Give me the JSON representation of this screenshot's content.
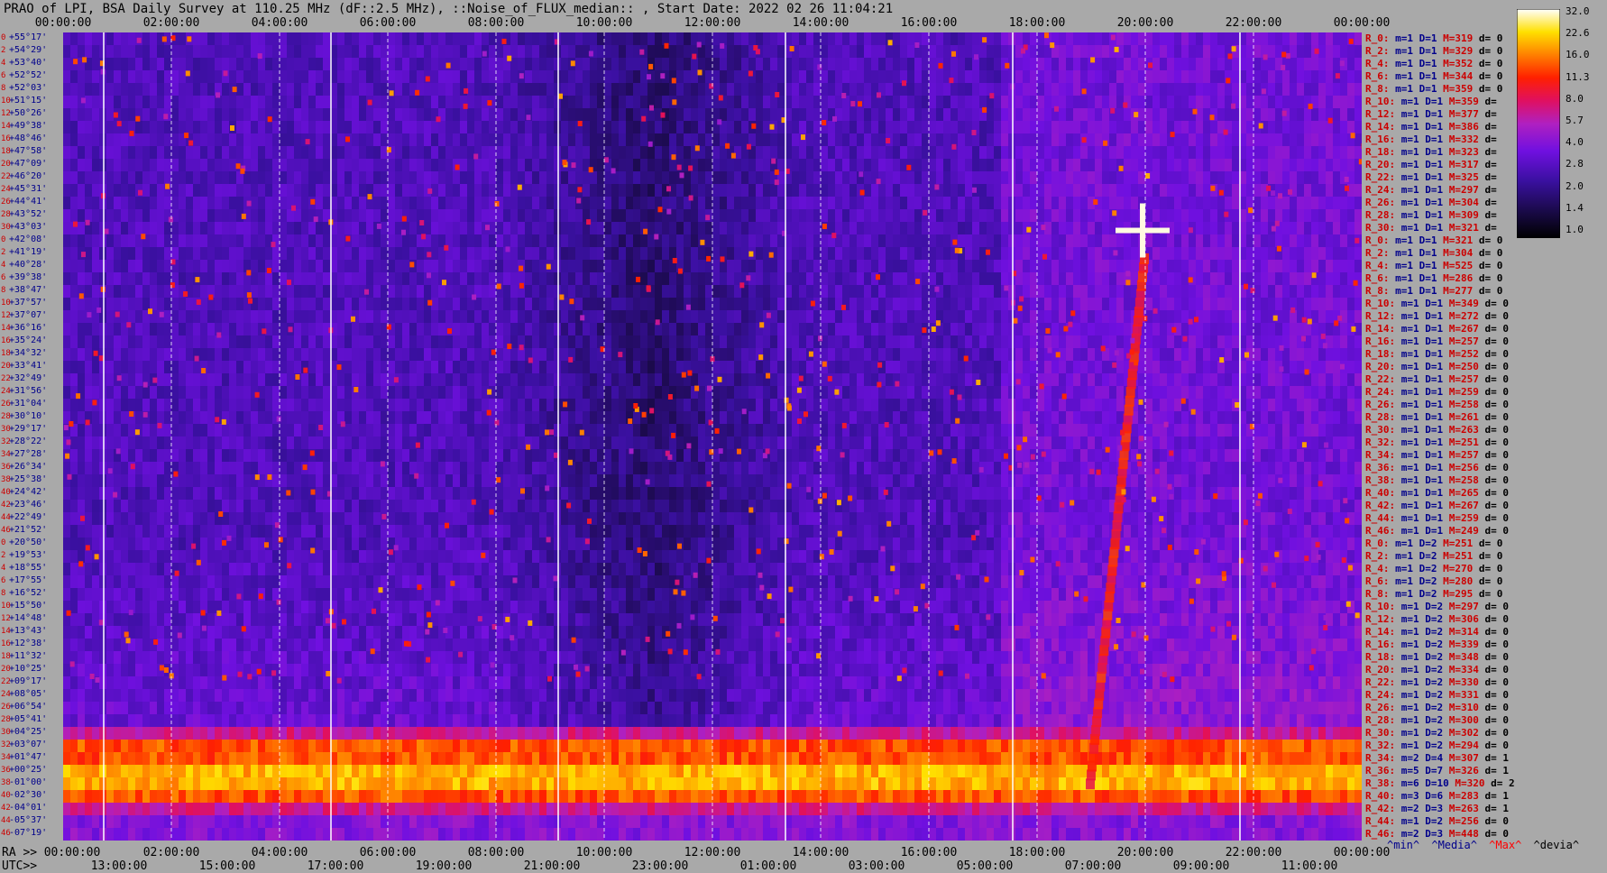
{
  "title": "PRAO of LPI, BSA Daily Survey at 110.25 MHz (dF::2.5 MHz), ::Noise_of_FLUX_median:: , Start Date: 2022 02 26 11:04:21",
  "top_ticks": [
    "00:00:00",
    "02:00:00",
    "04:00:00",
    "06:00:00",
    "08:00:00",
    "10:00:00",
    "12:00:00",
    "14:00:00",
    "16:00:00",
    "18:00:00",
    "20:00:00",
    "22:00:00",
    "00:00:00"
  ],
  "ra_label": "RA >>",
  "ra_ticks": [
    "00:00:00",
    "02:00:00",
    "04:00:00",
    "06:00:00",
    "08:00:00",
    "10:00:00",
    "12:00:00",
    "14:00:00",
    "16:00:00",
    "18:00:00",
    "20:00:00",
    "22:00:00",
    "00:00:00"
  ],
  "utc_label": "UTC>>",
  "utc_ticks": [
    "13:00:00",
    "15:00:00",
    "17:00:00",
    "19:00:00",
    "21:00:00",
    "23:00:00",
    "01:00:00",
    "03:00:00",
    "05:00:00",
    "07:00:00",
    "09:00:00",
    "11:00:00"
  ],
  "dec_labels": [
    "+55°17'",
    "+54°29'",
    "+53°40'",
    "+52°52'",
    "+52°03'",
    "+51°15'",
    "+50°26'",
    "+49°38'",
    "+48°46'",
    "+47°58'",
    "+47°09'",
    "+46°20'",
    "+45°31'",
    "+44°41'",
    "+43°52'",
    "+43°03'",
    "+42°08'",
    "+41°19'",
    "+40°28'",
    "+39°38'",
    "+38°47'",
    "+37°57'",
    "+37°07'",
    "+36°16'",
    "+35°24'",
    "+34°32'",
    "+33°41'",
    "+32°49'",
    "+31°56'",
    "+31°04'",
    "+30°10'",
    "+29°17'",
    "+28°22'",
    "+27°28'",
    "+26°34'",
    "+25°38'",
    "+24°42'",
    "+23°46'",
    "+22°49'",
    "+21°52'",
    "+20°50'",
    "+19°53'",
    "+18°55'",
    "+17°55'",
    "+16°52'",
    "+15°50'",
    "+14°48'",
    "+13°43'",
    "+12°38'",
    "+11°32'",
    "+10°25'",
    "+09°17'",
    "+08°05'",
    "+06°54'",
    "+05°41'",
    "+04°25'",
    "+03°07'",
    "+01°47'",
    "+00°25'",
    "-01°00'",
    "-02°30'",
    "-04°01'",
    "-05°37'",
    "-07°19'"
  ],
  "row_indices": [
    "0",
    "2",
    "4",
    "6",
    "8",
    "10",
    "12",
    "14",
    "16",
    "18",
    "20",
    "22",
    "24",
    "26",
    "28",
    "30",
    "0",
    "2",
    "4",
    "6",
    "8",
    "10",
    "12",
    "14",
    "16",
    "18",
    "20",
    "22",
    "24",
    "26",
    "28",
    "30",
    "32",
    "34",
    "36",
    "38",
    "40",
    "42",
    "44",
    "46",
    "0",
    "2",
    "4",
    "6",
    "8",
    "10",
    "12",
    "14",
    "16",
    "18",
    "20",
    "22",
    "24",
    "26",
    "28",
    "30",
    "32",
    "34",
    "36",
    "38",
    "40",
    "42",
    "44",
    "46"
  ],
  "stats": [
    {
      "r": "R_0:",
      "m": "m=1",
      "d": "D=1",
      "M": "M=319",
      "dev": "d= 0"
    },
    {
      "r": "R_2:",
      "m": "m=1",
      "d": "D=1",
      "M": "M=329",
      "dev": "d= 0"
    },
    {
      "r": "R_4:",
      "m": "m=1",
      "d": "D=1",
      "M": "M=352",
      "dev": "d= 0"
    },
    {
      "r": "R_6:",
      "m": "m=1",
      "d": "D=1",
      "M": "M=344",
      "dev": "d= 0"
    },
    {
      "r": "R_8:",
      "m": "m=1",
      "d": "D=1",
      "M": "M=359",
      "dev": "d= 0"
    },
    {
      "r": "R_10:",
      "m": "m=1",
      "d": "D=1",
      "M": "M=359",
      "dev": "d="
    },
    {
      "r": "R_12:",
      "m": "m=1",
      "d": "D=1",
      "M": "M=377",
      "dev": "d="
    },
    {
      "r": "R_14:",
      "m": "m=1",
      "d": "D=1",
      "M": "M=386",
      "dev": "d="
    },
    {
      "r": "R_16:",
      "m": "m=1",
      "d": "D=1",
      "M": "M=332",
      "dev": "d="
    },
    {
      "r": "R_18:",
      "m": "m=1",
      "d": "D=1",
      "M": "M=323",
      "dev": "d="
    },
    {
      "r": "R_20:",
      "m": "m=1",
      "d": "D=1",
      "M": "M=317",
      "dev": "d="
    },
    {
      "r": "R_22:",
      "m": "m=1",
      "d": "D=1",
      "M": "M=325",
      "dev": "d="
    },
    {
      "r": "R_24:",
      "m": "m=1",
      "d": "D=1",
      "M": "M=297",
      "dev": "d="
    },
    {
      "r": "R_26:",
      "m": "m=1",
      "d": "D=1",
      "M": "M=304",
      "dev": "d="
    },
    {
      "r": "R_28:",
      "m": "m=1",
      "d": "D=1",
      "M": "M=309",
      "dev": "d="
    },
    {
      "r": "R_30:",
      "m": "m=1",
      "d": "D=1",
      "M": "M=321",
      "dev": "d="
    },
    {
      "r": "R_0:",
      "m": "m=1",
      "d": "D=1",
      "M": "M=321",
      "dev": "d= 0"
    },
    {
      "r": "R_2:",
      "m": "m=1",
      "d": "D=1",
      "M": "M=304",
      "dev": "d= 0"
    },
    {
      "r": "R_4:",
      "m": "m=1",
      "d": "D=1",
      "M": "M=525",
      "dev": "d= 0"
    },
    {
      "r": "R_6:",
      "m": "m=1",
      "d": "D=1",
      "M": "M=286",
      "dev": "d= 0"
    },
    {
      "r": "R_8:",
      "m": "m=1",
      "d": "D=1",
      "M": "M=277",
      "dev": "d= 0"
    },
    {
      "r": "R_10:",
      "m": "m=1",
      "d": "D=1",
      "M": "M=349",
      "dev": "d= 0"
    },
    {
      "r": "R_12:",
      "m": "m=1",
      "d": "D=1",
      "M": "M=272",
      "dev": "d= 0"
    },
    {
      "r": "R_14:",
      "m": "m=1",
      "d": "D=1",
      "M": "M=267",
      "dev": "d= 0"
    },
    {
      "r": "R_16:",
      "m": "m=1",
      "d": "D=1",
      "M": "M=257",
      "dev": "d= 0"
    },
    {
      "r": "R_18:",
      "m": "m=1",
      "d": "D=1",
      "M": "M=252",
      "dev": "d= 0"
    },
    {
      "r": "R_20:",
      "m": "m=1",
      "d": "D=1",
      "M": "M=250",
      "dev": "d= 0"
    },
    {
      "r": "R_22:",
      "m": "m=1",
      "d": "D=1",
      "M": "M=257",
      "dev": "d= 0"
    },
    {
      "r": "R_24:",
      "m": "m=1",
      "d": "D=1",
      "M": "M=259",
      "dev": "d= 0"
    },
    {
      "r": "R_26:",
      "m": "m=1",
      "d": "D=1",
      "M": "M=258",
      "dev": "d= 0"
    },
    {
      "r": "R_28:",
      "m": "m=1",
      "d": "D=1",
      "M": "M=261",
      "dev": "d= 0"
    },
    {
      "r": "R_30:",
      "m": "m=1",
      "d": "D=1",
      "M": "M=263",
      "dev": "d= 0"
    },
    {
      "r": "R_32:",
      "m": "m=1",
      "d": "D=1",
      "M": "M=251",
      "dev": "d= 0"
    },
    {
      "r": "R_34:",
      "m": "m=1",
      "d": "D=1",
      "M": "M=257",
      "dev": "d= 0"
    },
    {
      "r": "R_36:",
      "m": "m=1",
      "d": "D=1",
      "M": "M=256",
      "dev": "d= 0"
    },
    {
      "r": "R_38:",
      "m": "m=1",
      "d": "D=1",
      "M": "M=258",
      "dev": "d= 0"
    },
    {
      "r": "R_40:",
      "m": "m=1",
      "d": "D=1",
      "M": "M=265",
      "dev": "d= 0"
    },
    {
      "r": "R_42:",
      "m": "m=1",
      "d": "D=1",
      "M": "M=267",
      "dev": "d= 0"
    },
    {
      "r": "R_44:",
      "m": "m=1",
      "d": "D=1",
      "M": "M=259",
      "dev": "d= 0"
    },
    {
      "r": "R_46:",
      "m": "m=1",
      "d": "D=1",
      "M": "M=249",
      "dev": "d= 0"
    },
    {
      "r": "R_0:",
      "m": "m=1",
      "d": "D=2",
      "M": "M=251",
      "dev": "d= 0"
    },
    {
      "r": "R_2:",
      "m": "m=1",
      "d": "D=2",
      "M": "M=251",
      "dev": "d= 0"
    },
    {
      "r": "R_4:",
      "m": "m=1",
      "d": "D=2",
      "M": "M=270",
      "dev": "d= 0"
    },
    {
      "r": "R_6:",
      "m": "m=1",
      "d": "D=2",
      "M": "M=280",
      "dev": "d= 0"
    },
    {
      "r": "R_8:",
      "m": "m=1",
      "d": "D=2",
      "M": "M=295",
      "dev": "d= 0"
    },
    {
      "r": "R_10:",
      "m": "m=1",
      "d": "D=2",
      "M": "M=297",
      "dev": "d= 0"
    },
    {
      "r": "R_12:",
      "m": "m=1",
      "d": "D=2",
      "M": "M=306",
      "dev": "d= 0"
    },
    {
      "r": "R_14:",
      "m": "m=1",
      "d": "D=2",
      "M": "M=314",
      "dev": "d= 0"
    },
    {
      "r": "R_16:",
      "m": "m=1",
      "d": "D=2",
      "M": "M=339",
      "dev": "d= 0"
    },
    {
      "r": "R_18:",
      "m": "m=1",
      "d": "D=2",
      "M": "M=348",
      "dev": "d= 0"
    },
    {
      "r": "R_20:",
      "m": "m=1",
      "d": "D=2",
      "M": "M=334",
      "dev": "d= 0"
    },
    {
      "r": "R_22:",
      "m": "m=1",
      "d": "D=2",
      "M": "M=330",
      "dev": "d= 0"
    },
    {
      "r": "R_24:",
      "m": "m=1",
      "d": "D=2",
      "M": "M=331",
      "dev": "d= 0"
    },
    {
      "r": "R_26:",
      "m": "m=1",
      "d": "D=2",
      "M": "M=310",
      "dev": "d= 0"
    },
    {
      "r": "R_28:",
      "m": "m=1",
      "d": "D=2",
      "M": "M=300",
      "dev": "d= 0"
    },
    {
      "r": "R_30:",
      "m": "m=1",
      "d": "D=2",
      "M": "M=302",
      "dev": "d= 0"
    },
    {
      "r": "R_32:",
      "m": "m=1",
      "d": "D=2",
      "M": "M=294",
      "dev": "d= 0"
    },
    {
      "r": "R_34:",
      "m": "m=2",
      "d": "D=4",
      "M": "M=307",
      "dev": "d= 1"
    },
    {
      "r": "R_36:",
      "m": "m=5",
      "d": "D=7",
      "M": "M=326",
      "dev": "d= 1"
    },
    {
      "r": "R_38:",
      "m": "m=6",
      "d": "D=10",
      "M": "M=320",
      "dev": "d= 2"
    },
    {
      "r": "R_40:",
      "m": "m=3",
      "d": "D=6",
      "M": "M=283",
      "dev": "d= 1"
    },
    {
      "r": "R_42:",
      "m": "m=2",
      "d": "D=3",
      "M": "M=263",
      "dev": "d= 1"
    },
    {
      "r": "R_44:",
      "m": "m=1",
      "d": "D=2",
      "M": "M=256",
      "dev": "d= 0"
    },
    {
      "r": "R_46:",
      "m": "m=2",
      "d": "D=3",
      "M": "M=448",
      "dev": "d= 0"
    }
  ],
  "colorbar_labels": [
    "32.0",
    "22.6",
    "16.0",
    "11.3",
    "8.0",
    "5.7",
    "4.0",
    "2.8",
    "2.0",
    "1.4",
    "1.0"
  ],
  "legend": {
    "min": "^min^",
    "median": "^Media^",
    "max": "^Max^",
    "devia": "^devia^"
  },
  "colors": {
    "background": "#a9a9a9",
    "min": "#00008b",
    "median": "#00008b",
    "max": "#ff0000",
    "devia": "#000000"
  },
  "chart_data": {
    "type": "heatmap",
    "title": "PRAO of LPI, BSA Daily Survey at 110.25 MHz (dF::2.5 MHz), ::Noise_of_FLUX_median:: , Start Date: 2022 02 26 11:04:21",
    "x_axis_ra": [
      "00:00:00",
      "02:00:00",
      "04:00:00",
      "06:00:00",
      "08:00:00",
      "10:00:00",
      "12:00:00",
      "14:00:00",
      "16:00:00",
      "18:00:00",
      "20:00:00",
      "22:00:00",
      "00:00:00"
    ],
    "x_axis_utc": [
      "13:00:00",
      "15:00:00",
      "17:00:00",
      "19:00:00",
      "21:00:00",
      "23:00:00",
      "01:00:00",
      "03:00:00",
      "05:00:00",
      "07:00:00",
      "09:00:00",
      "11:00:00"
    ],
    "y_axis_dec_range": [
      "+55°17'",
      "-07°19'"
    ],
    "colorbar_range": [
      1.0,
      32.0
    ],
    "colorbar_scale": "log2",
    "features": [
      {
        "kind": "bright horizontal band",
        "dec_range": [
          "+01°47'",
          "-04°01'"
        ],
        "ra_range": [
          "00:00:00",
          "24:00:00"
        ]
      },
      {
        "kind": "diagonal bright streak",
        "ra_start": "19:00:00",
        "dec_start": "+03°07'",
        "ra_end": "20:00:00",
        "dec_end": "+42°08'"
      },
      {
        "kind": "point source",
        "ra": "19:57:00",
        "dec": "+40°30'"
      }
    ],
    "grid": true
  }
}
